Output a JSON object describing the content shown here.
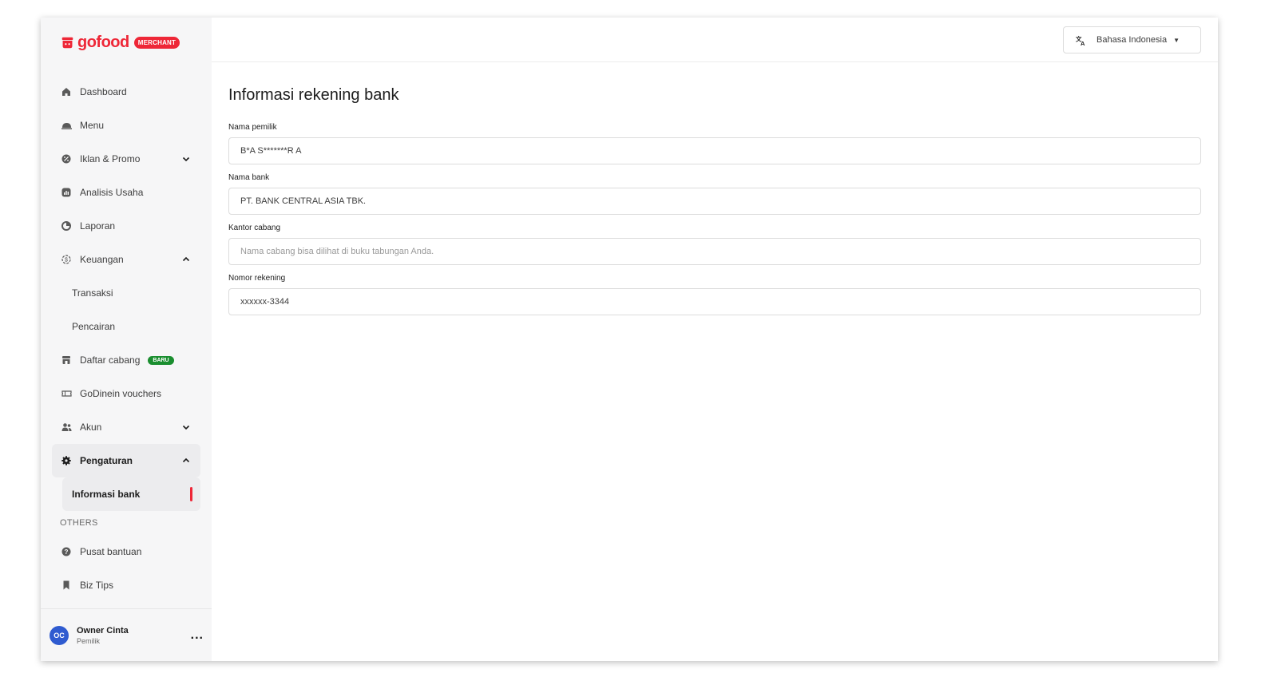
{
  "brand": {
    "name": "gofood",
    "badge": "MERCHANT",
    "accent_color": "#ee2737"
  },
  "sidebar": {
    "items": [
      {
        "label": "Dashboard",
        "icon": "home-icon"
      },
      {
        "label": "Menu",
        "icon": "cloche-icon"
      },
      {
        "label": "Iklan & Promo",
        "icon": "promo-icon",
        "chevron": "down"
      },
      {
        "label": "Analisis Usaha",
        "icon": "analytics-icon"
      },
      {
        "label": "Laporan",
        "icon": "report-icon"
      },
      {
        "label": "Keuangan",
        "icon": "finance-icon",
        "chevron": "up"
      },
      {
        "label": "Transaksi"
      },
      {
        "label": "Pencairan"
      },
      {
        "label": "Daftar cabang",
        "icon": "store-icon",
        "badge": "BARU"
      },
      {
        "label": "GoDinein vouchers",
        "icon": "voucher-icon"
      },
      {
        "label": "Akun",
        "icon": "users-icon",
        "chevron": "down"
      },
      {
        "label": "Pengaturan",
        "icon": "gear-icon",
        "chevron": "up"
      },
      {
        "label": "Informasi bank"
      }
    ],
    "others_title": "OTHERS",
    "others": [
      {
        "label": "Pusat bantuan",
        "icon": "help-icon"
      },
      {
        "label": "Biz Tips",
        "icon": "bookmark-icon"
      }
    ],
    "user": {
      "initials": "OC",
      "name": "Owner Cinta",
      "role": "Pemilik",
      "more": "..."
    }
  },
  "topbar": {
    "language": "Bahasa Indonesia"
  },
  "main": {
    "title": "Informasi rekening bank",
    "fields": [
      {
        "label": "Nama pemilik",
        "value": "B*A S*******R A",
        "placeholder": ""
      },
      {
        "label": "Nama bank",
        "value": "PT. BANK CENTRAL ASIA TBK.",
        "placeholder": ""
      },
      {
        "label": "Kantor cabang",
        "value": "",
        "placeholder": "Nama cabang bisa dilihat di buku tabungan Anda."
      },
      {
        "label": "Nomor rekening",
        "value": "xxxxxx-3344",
        "placeholder": ""
      }
    ]
  }
}
